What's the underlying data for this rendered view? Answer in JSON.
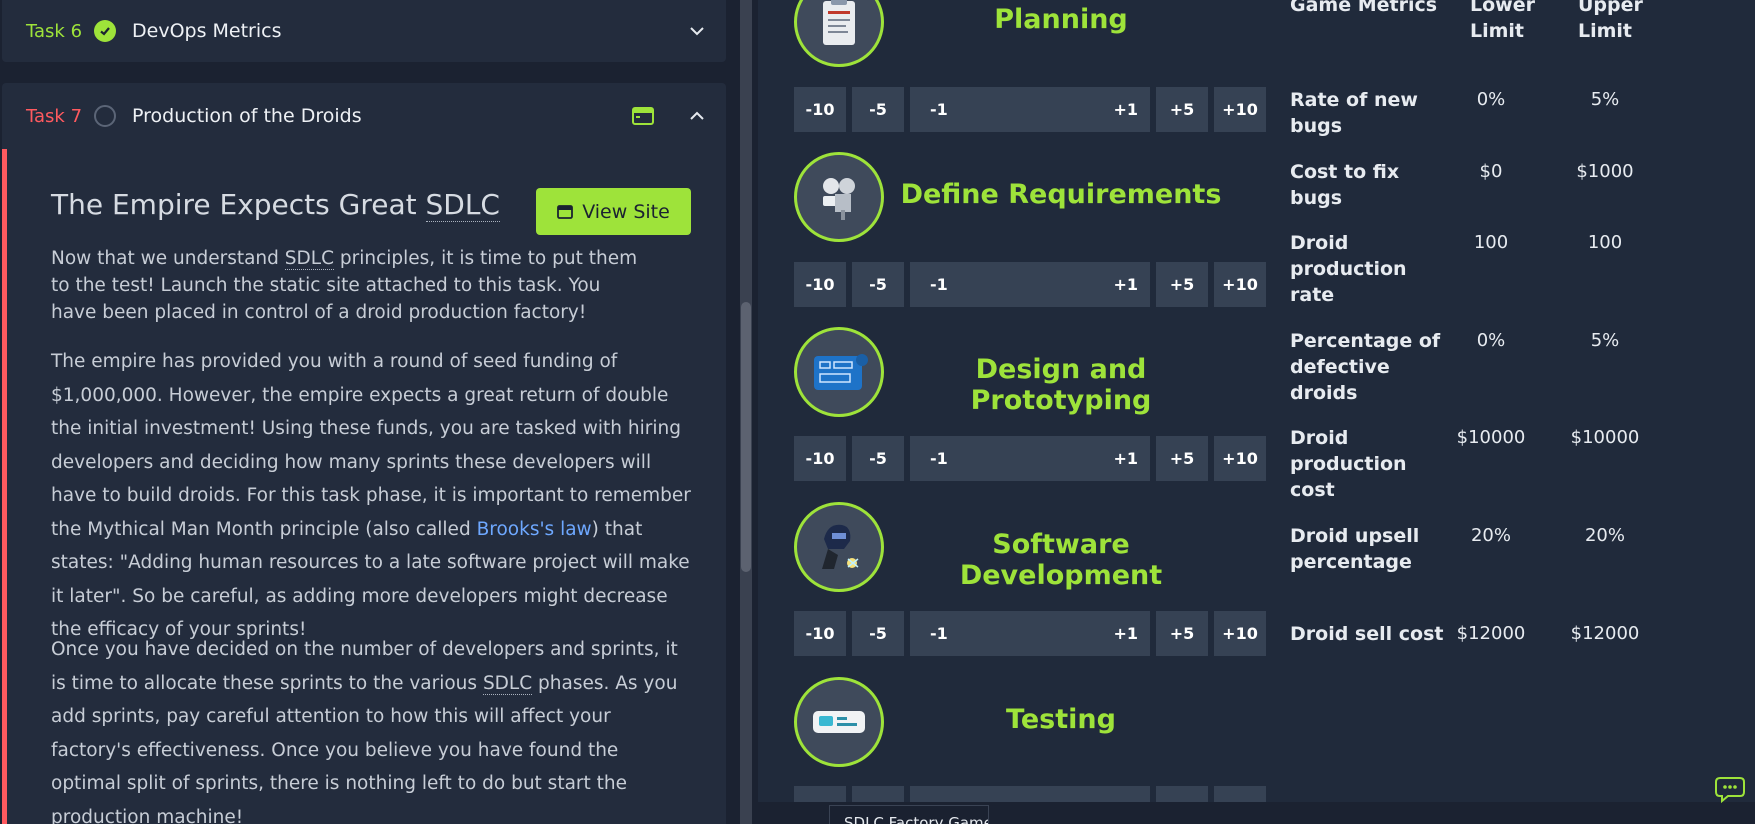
{
  "tasks": {
    "task6": {
      "number": "Task 6",
      "title": "DevOps Metrics"
    },
    "task7": {
      "number": "Task 7",
      "title": "Production of the Droids",
      "heading_pre": "The Empire Expects Great ",
      "heading_abbr": "SDLC",
      "view_site_label": "View Site",
      "p1_pre": "Now that we understand ",
      "p1_abbr": "SDLC",
      "p1_post": " principles, it is time to put them to the test! Launch the static site attached to this task. You have been placed in control of a droid production factory!",
      "p2_pre": "The empire has provided you with a round of seed funding of $1,000,000. However, the empire expects a great return of double the initial investment! Using these funds, you are tasked with hiring developers and deciding how many sprints these developers will have to build droids. For this task phase, it is important to remember the Mythical Man Month principle (also called ",
      "p2_link": "Brooks's law",
      "p2_post": ") that states: \"Adding human resources to a late software project will make it later\". So be careful, as adding more developers might decrease the efficacy of your sprints!",
      "p3_pre": "Once you have decided on the number of developers and sprints, it is time to allocate these sprints to the various ",
      "p3_abbr": "SDLC",
      "p3_post": " phases. As you add sprints, pay careful attention to how this will affect your factory's effectiveness. Once you believe you have found the optimal split of sprints, there is nothing left to do but start the production machine!"
    }
  },
  "controls": {
    "m10": "-10",
    "m5": "-5",
    "m1": "-1",
    "p1": "+1",
    "p5": "+5",
    "p10": "+10"
  },
  "phases": [
    {
      "title": "Planning",
      "icon": "clipboard-icon"
    },
    {
      "title": "Define Requirements",
      "icon": "bolts-icon"
    },
    {
      "title": "Design and Prototyping",
      "icon": "blueprint-icon"
    },
    {
      "title": "Software Development",
      "icon": "welder-icon"
    },
    {
      "title": "Testing",
      "icon": "test-device-icon"
    }
  ],
  "metrics": {
    "header_name": "Game Metrics",
    "header_lower": "Lower Limit",
    "header_upper": "Upper Limit",
    "rows": [
      {
        "name": "Rate of new bugs",
        "lower": "0%",
        "upper": "5%"
      },
      {
        "name": "Cost to fix bugs",
        "lower": "$0",
        "upper": "$1000"
      },
      {
        "name": "Droid production rate",
        "lower": "100",
        "upper": "100"
      },
      {
        "name": "Percentage of defective droids",
        "lower": "0%",
        "upper": "5%"
      },
      {
        "name": "Droid production cost",
        "lower": "$10000",
        "upper": "$10000"
      },
      {
        "name": "Droid upsell percentage",
        "lower": "20%",
        "upper": "20%"
      },
      {
        "name": "Droid sell cost",
        "lower": "$12000",
        "upper": "$12000"
      }
    ]
  },
  "bottom_tab": "SDLC Factory Game",
  "colors": {
    "accent": "#9ee33a",
    "danger": "#ff5a5f",
    "link": "#6ea8ff"
  }
}
